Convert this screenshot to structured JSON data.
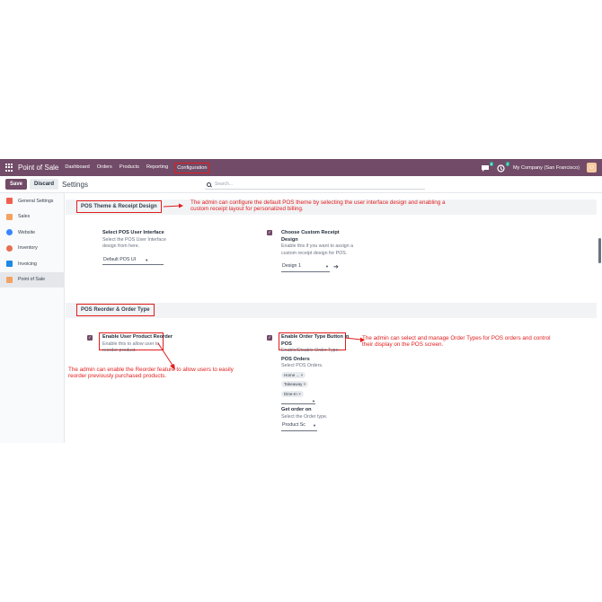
{
  "nav": {
    "app_name": "Point of Sale",
    "menu": [
      "Dashboard",
      "Orders",
      "Products",
      "Reporting",
      "Configuration"
    ],
    "msg_count": "8",
    "activity_count": "2",
    "company": "My Company (San Francisco)"
  },
  "control": {
    "save": "Save",
    "discard": "Discard",
    "title": "Settings",
    "search_placeholder": "Search..."
  },
  "sidebar": {
    "items": [
      {
        "label": "General Settings",
        "color": "#f06050"
      },
      {
        "label": "Sales",
        "color": "#f4a261"
      },
      {
        "label": "Website",
        "color": "#3a86ff"
      },
      {
        "label": "Inventory",
        "color": "#e76f51"
      },
      {
        "label": "Invoicing",
        "color": "#1e88e5"
      },
      {
        "label": "Point of Sale",
        "color": "#f4a261"
      }
    ]
  },
  "sections": {
    "theme": {
      "title": "POS Theme & Receipt Design",
      "annotation": "The admin can configure the default POS theme by selecting the user interface design and enabling a custom receipt layout for personalized billing.",
      "ui_label": "Select POS User Interface",
      "ui_help": "Select the POS User Interface design from here.",
      "ui_value": "Default POS UI",
      "receipt_label": "Choose Custom Receipt Design",
      "receipt_help": "Enable this if you want to assign a custom receipt design for POS.",
      "receipt_value": "Design 1"
    },
    "reorder": {
      "title": "POS Reorder & Order Type",
      "reorder_label": "Enable User Product Reorder",
      "reorder_help": "Enable this to allow user to reorder product.",
      "reorder_annotation": "The admin can enable the Reorder feature to allow users to easily reorder previously purchased products.",
      "ordertype_label": "Enable Order Type Button in POS",
      "ordertype_help": "Enable/Disable Order Type.",
      "ordertype_annotation": "The admin can select and manage Order Types for POS orders and control their display on the POS screen.",
      "pos_orders_label": "POS Orders",
      "pos_orders_help": "Select POS Orders.",
      "tags": [
        "Home ... ×",
        "Takeaway ×",
        "Dine-In ×"
      ],
      "get_order_label": "Get order on",
      "get_order_help": "Select the Order type.",
      "get_order_value": "Product Sc"
    }
  }
}
